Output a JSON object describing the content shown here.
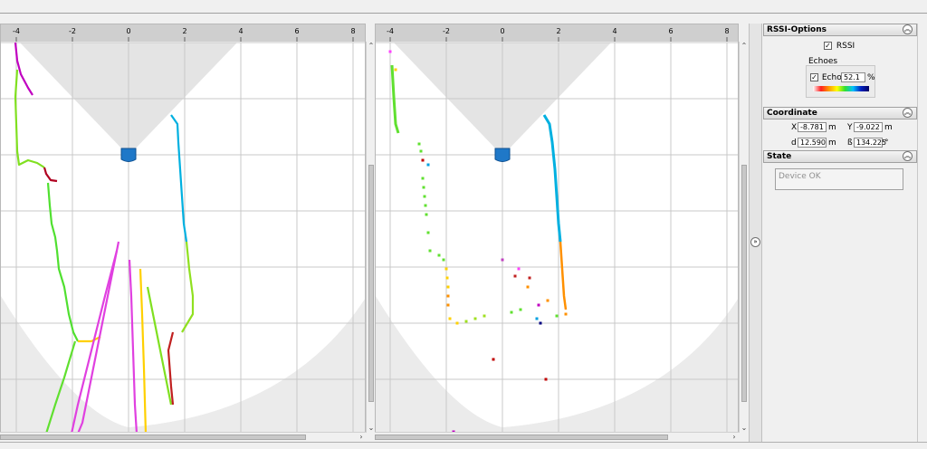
{
  "rssi_options": {
    "title": "RSSI-Options",
    "rssi_checkbox": {
      "label": "RSSI",
      "checked": true
    },
    "echoes_group": "Echoes",
    "echo1": {
      "label": "Echo1",
      "checked": true,
      "value": "52.1",
      "unit": "%"
    }
  },
  "coordinate": {
    "title": "Coordinate",
    "x_label": "X",
    "x_value": "-8.781",
    "x_unit": "m",
    "y_label": "Y",
    "y_value": "-9.022",
    "y_unit": "m",
    "d_label": "d",
    "d_value": "12.590",
    "d_unit": "m",
    "b_label": "ß",
    "b_value": "134.225",
    "b_unit": "°"
  },
  "state": {
    "title": "State",
    "status": "Device OK"
  },
  "views": {
    "tick_labels": [
      "-4",
      "-2",
      "0",
      "2",
      "4",
      "6",
      "8"
    ]
  },
  "icons": {
    "collapse_up": "double-chevron-up-icon",
    "expand_right": "double-chevron-right-icon",
    "sensor": "sensor-icon"
  },
  "colors": {
    "fov": "#e4e4e4",
    "grid": "#c8c8c8",
    "sensor": "#1f78c8",
    "ruler": "#cfcfcf"
  }
}
